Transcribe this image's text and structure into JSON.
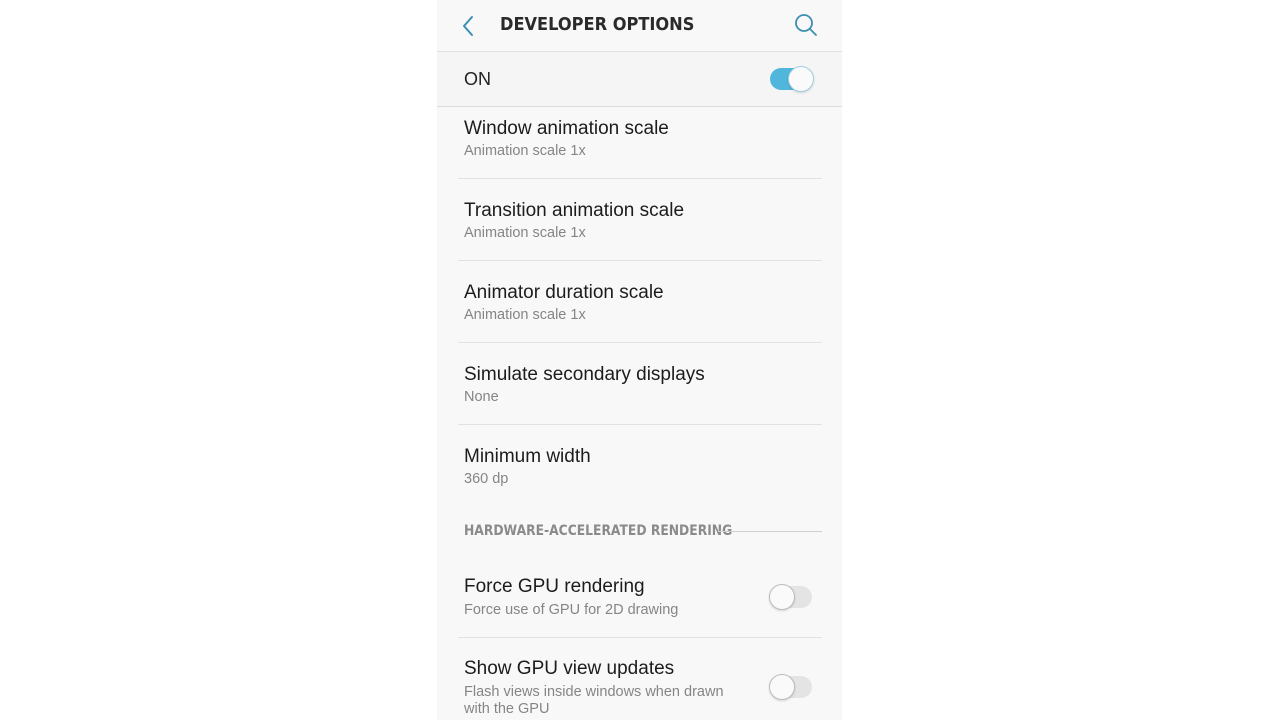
{
  "header": {
    "title": "DEVELOPER OPTIONS",
    "back_icon": "chevron-left-icon",
    "search_icon": "search-icon",
    "accent_color": "#3b8fb3"
  },
  "master_switch": {
    "label": "ON",
    "state": "on",
    "on_color": "#50b6dc"
  },
  "items": [
    {
      "title": "Window animation scale",
      "summary": "Animation scale 1x"
    },
    {
      "title": "Transition animation scale",
      "summary": "Animation scale 1x"
    },
    {
      "title": "Animator duration scale",
      "summary": "Animation scale 1x"
    },
    {
      "title": "Simulate secondary displays",
      "summary": "None"
    },
    {
      "title": "Minimum width",
      "summary": "360 dp"
    }
  ],
  "section": {
    "title": "HARDWARE-ACCELERATED RENDERING"
  },
  "toggle_items": [
    {
      "title": "Force GPU rendering",
      "summary": "Force use of GPU for 2D drawing",
      "state": "off"
    },
    {
      "title": "Show GPU view updates",
      "summary_line1": "Flash views inside windows when drawn",
      "summary_line2": "with the GPU",
      "state": "off"
    }
  ]
}
